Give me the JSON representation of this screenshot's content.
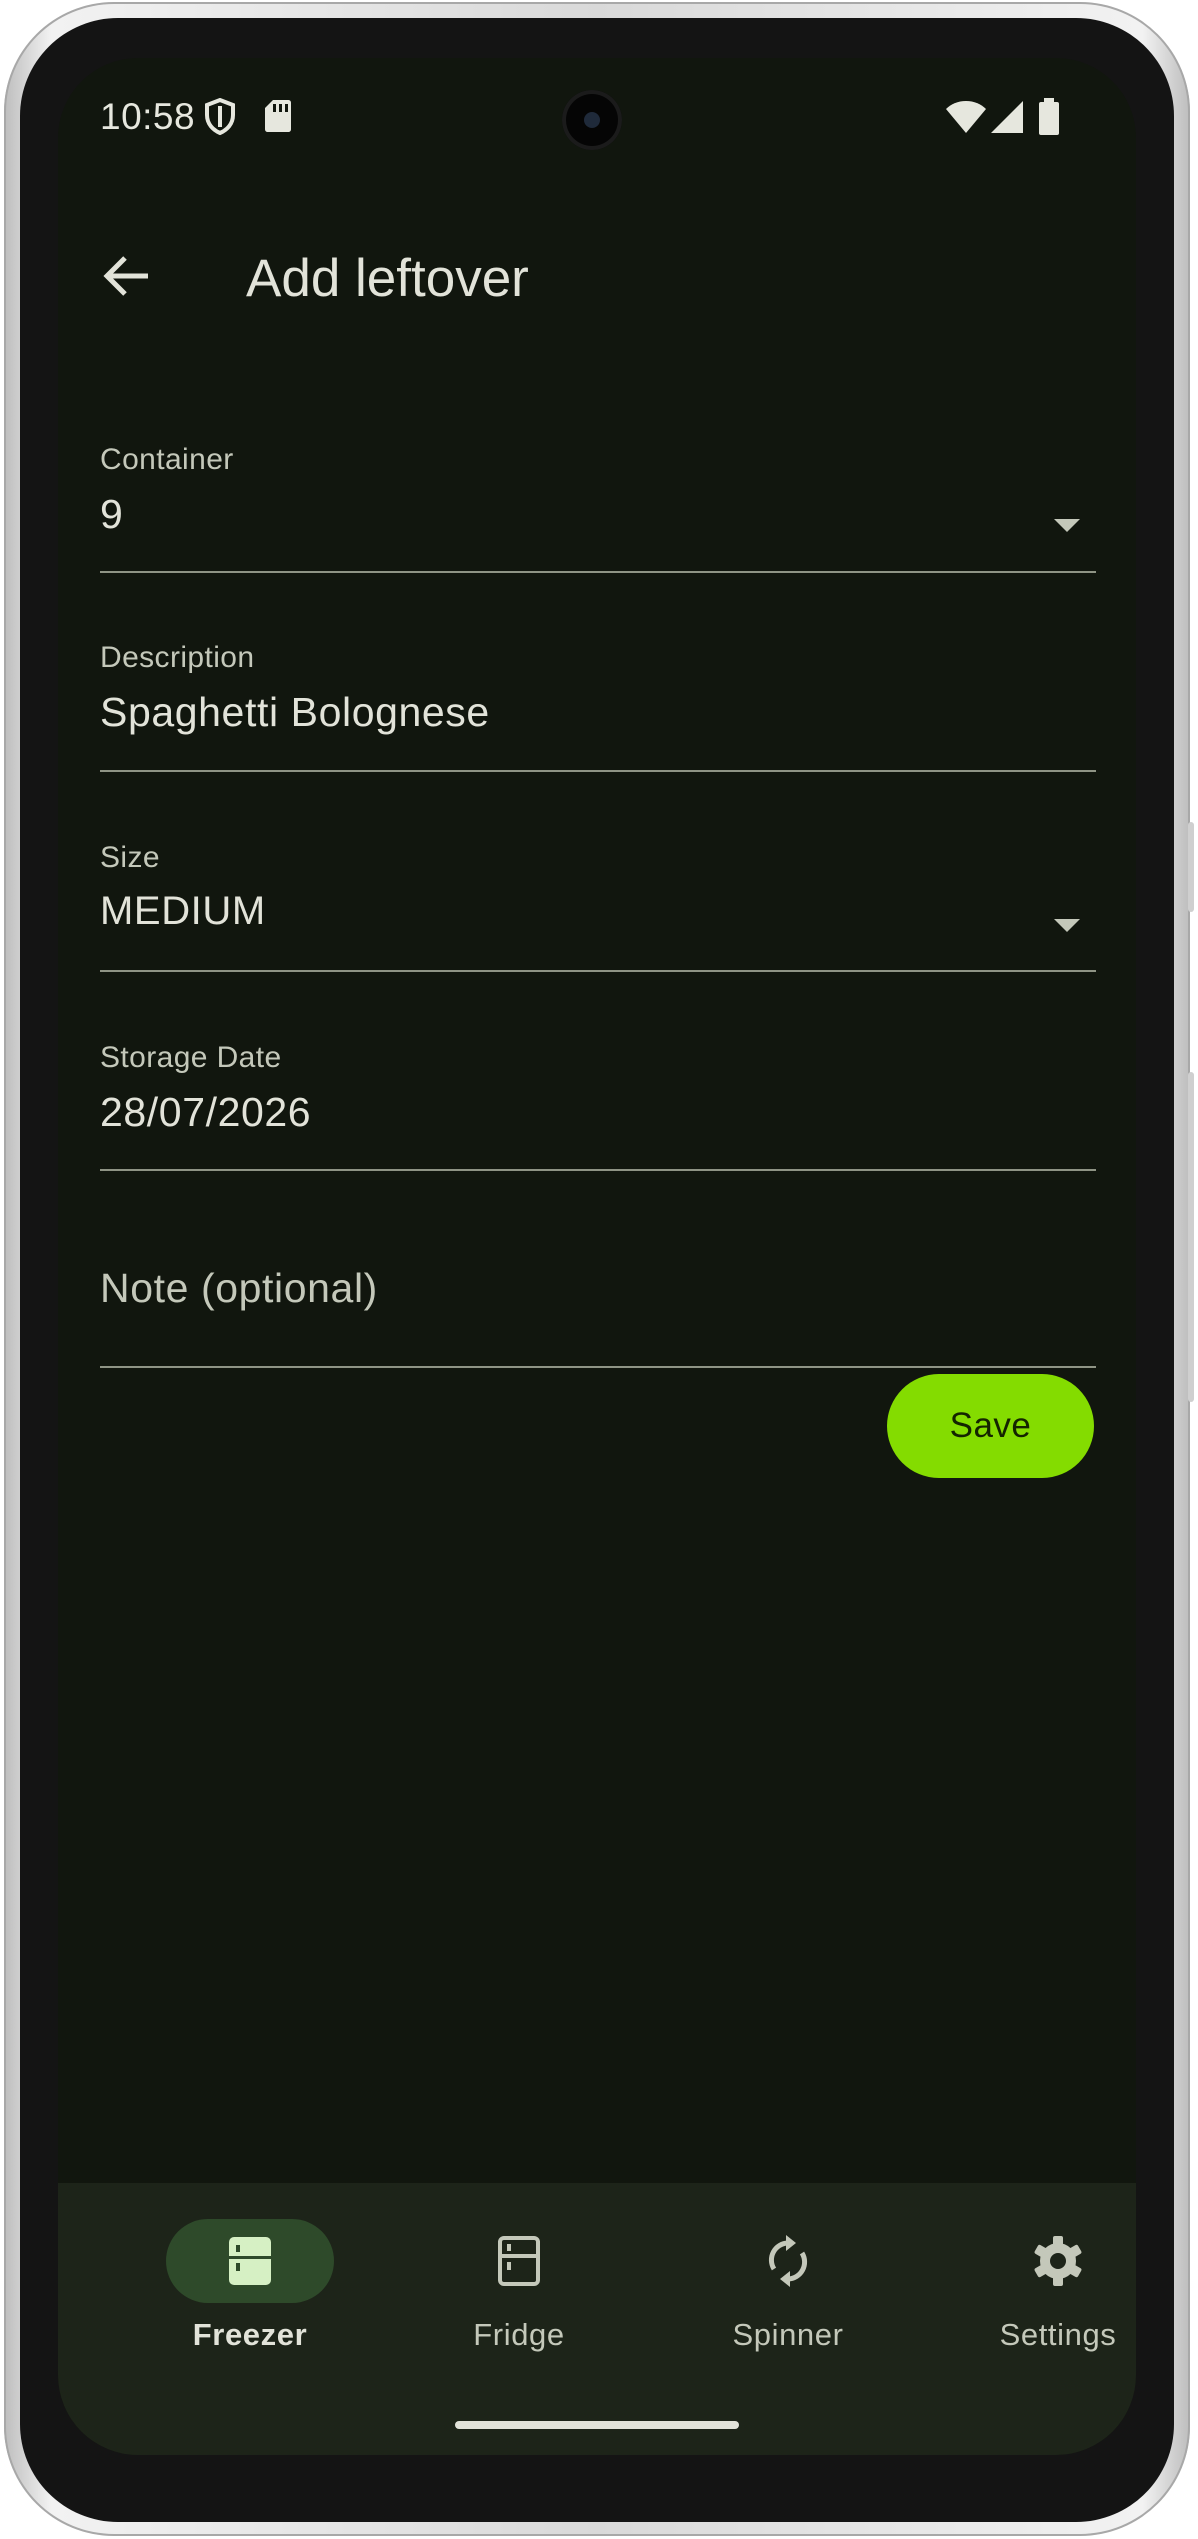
{
  "status_bar": {
    "time": "10:58",
    "icons": [
      "shield-icon",
      "sd-card-icon",
      "wifi-icon",
      "cellular-signal-icon",
      "battery-icon"
    ]
  },
  "app_bar": {
    "title": "Add leftover",
    "back_icon": "arrow-back-icon"
  },
  "form": {
    "container": {
      "label": "Container",
      "value": "9"
    },
    "description": {
      "label": "Description",
      "value": "Spaghetti Bolognese"
    },
    "size": {
      "label": "Size",
      "value": "MEDIUM"
    },
    "storage_date": {
      "label": "Storage Date",
      "value": "28/07/2026"
    },
    "note": {
      "placeholder": "Note (optional)",
      "value": ""
    },
    "save_label": "Save"
  },
  "bottom_nav": {
    "items": [
      {
        "label": "Freezer",
        "icon": "freezer-icon",
        "active": true
      },
      {
        "label": "Fridge",
        "icon": "fridge-icon",
        "active": false
      },
      {
        "label": "Spinner",
        "icon": "refresh-icon",
        "active": false
      },
      {
        "label": "Settings",
        "icon": "gear-icon",
        "active": false
      }
    ]
  },
  "colors": {
    "background": "#11160e",
    "nav_background": "#1d2419",
    "accent": "#84dc00",
    "active_indicator": "#2e4a2a",
    "text_primary": "#e2e3d9",
    "text_secondary": "#c4c8ba"
  }
}
